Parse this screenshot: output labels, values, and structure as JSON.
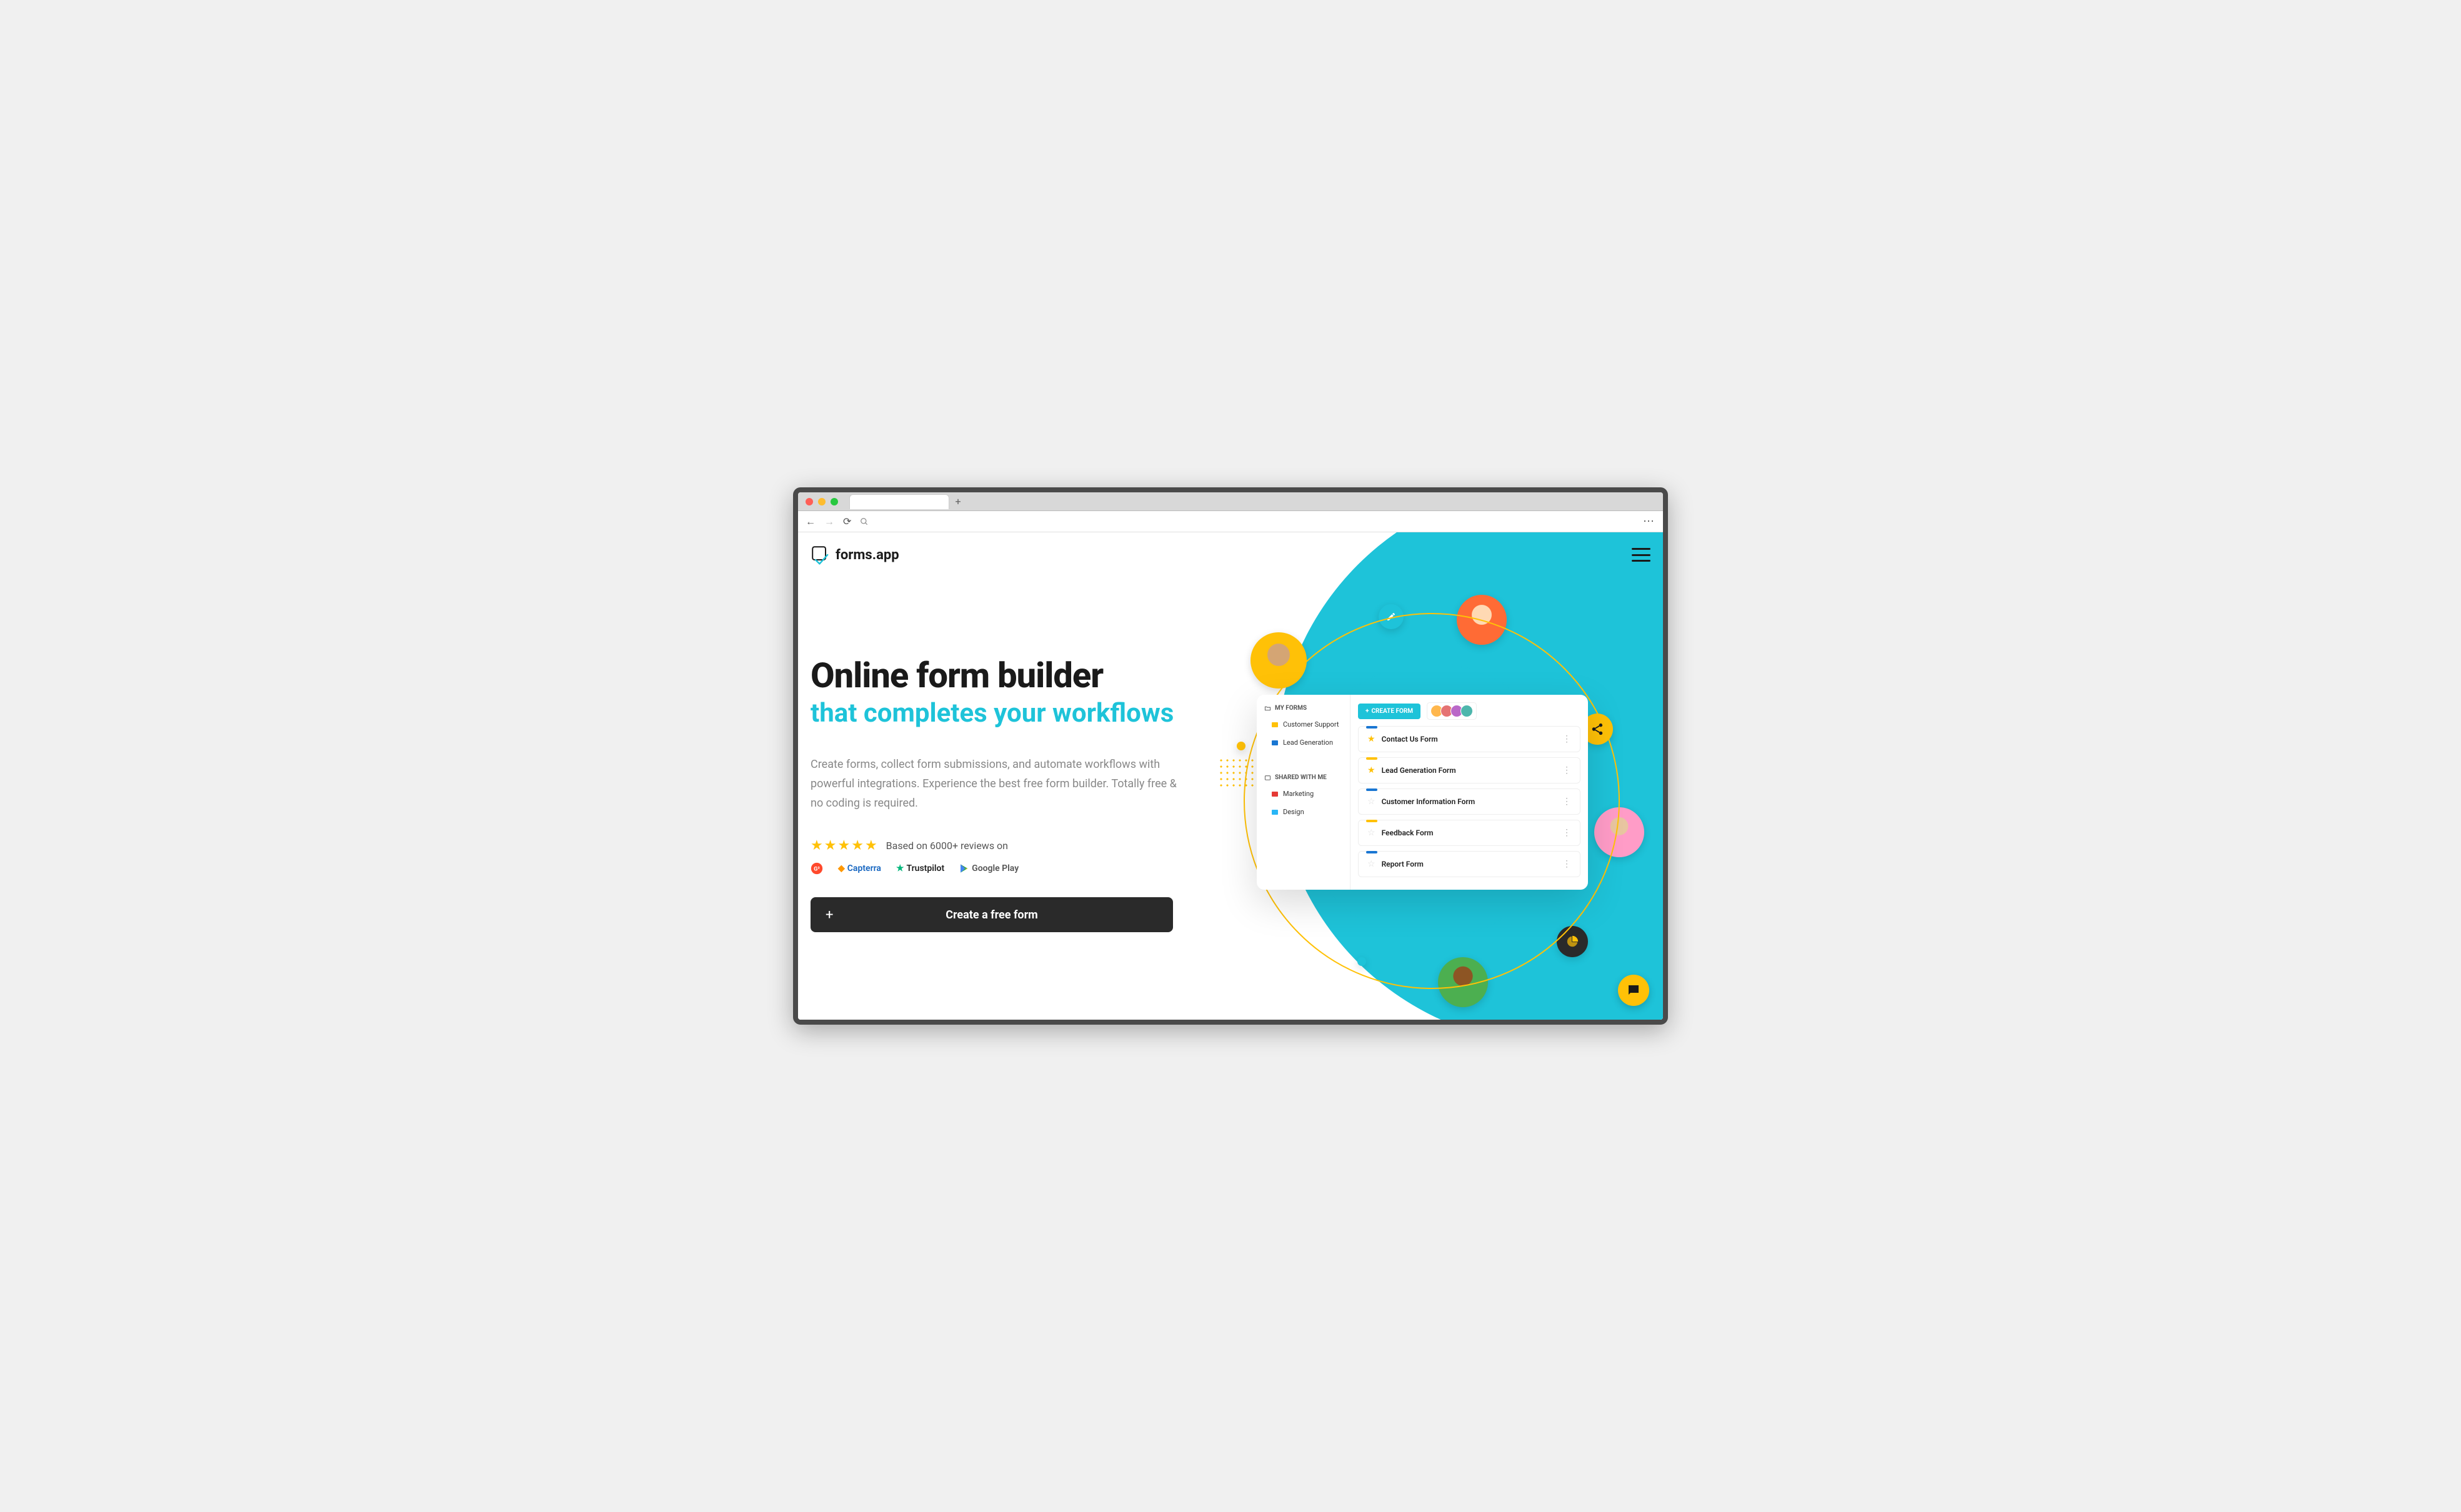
{
  "nav": {
    "brand": "forms.app"
  },
  "hero": {
    "title1": "Online form builder",
    "title2": "that completes your workflows",
    "desc": "Create forms, collect form submissions, and automate workflows with powerful integrations. Experience the best free form builder. Totally free & no coding is required.",
    "rated": "Based on 6000+ reviews on",
    "cta": "Create a free form"
  },
  "brands": {
    "g2": "G2",
    "capterra": "Capterra",
    "trustpilot": "Trustpilot",
    "gplay": "Google Play"
  },
  "mock": {
    "myforms": "MY FORMS",
    "shared": "SHARED WITH ME",
    "create": "CREATE FORM",
    "folders1": [
      {
        "label": "Customer Support",
        "color": "#ffc107"
      },
      {
        "label": "Lead Generation",
        "color": "#1976d2"
      }
    ],
    "folders2": [
      {
        "label": "Marketing",
        "color": "#e53935"
      },
      {
        "label": "Design",
        "color": "#29b6f6"
      }
    ],
    "rows": [
      {
        "title": "Contact Us Form",
        "star": true,
        "bar": "#1976d2"
      },
      {
        "title": "Lead Generation Form",
        "star": true,
        "bar": "#ffc107"
      },
      {
        "title": "Customer Information Form",
        "star": false,
        "bar": "#1976d2"
      },
      {
        "title": "Feedback Form",
        "star": false,
        "bar": "#ffc107"
      },
      {
        "title": "Report Form",
        "star": false,
        "bar": "#1976d2"
      }
    ]
  }
}
